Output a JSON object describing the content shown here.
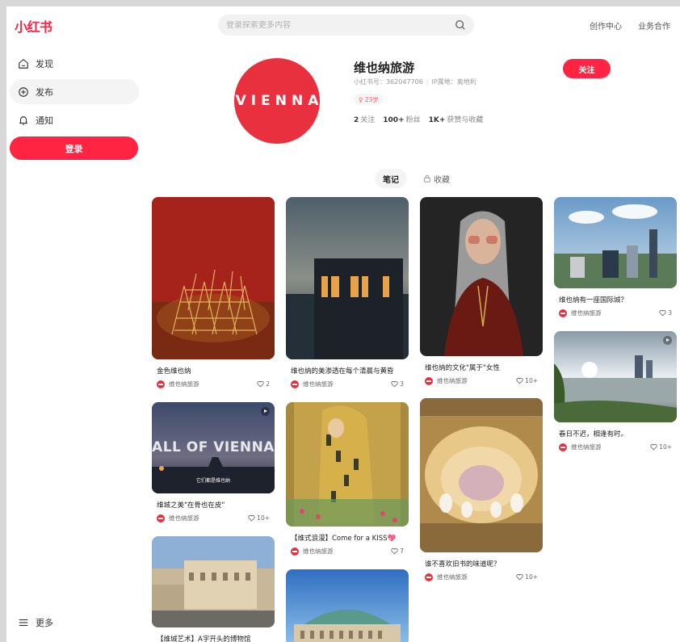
{
  "app": {
    "logo": "小红书"
  },
  "search": {
    "placeholder": "登录探索更多内容"
  },
  "topnav": {
    "creator": "创作中心",
    "business": "业务合作"
  },
  "sidebar": {
    "items": [
      {
        "label": "发现",
        "icon": "home-icon"
      },
      {
        "label": "发布",
        "icon": "plus-icon"
      },
      {
        "label": "通知",
        "icon": "bell-icon"
      }
    ],
    "login": "登录",
    "more": "更多"
  },
  "profile": {
    "avatar_text": "VIENNA",
    "name": "维也纳旅游",
    "id_label": "小红书号：362047706",
    "ip_label": "IP属地：奥地利",
    "tag": "♀ 23岁",
    "following": "2",
    "following_label": "关注",
    "fans": "100+",
    "fans_label": "粉丝",
    "likes": "1K+",
    "likes_label": "获赞与收藏",
    "follow_btn": "关注"
  },
  "tabs": {
    "notes": "笔记",
    "collect": "收藏"
  },
  "cards": [
    {
      "title": "金色维也纳",
      "author": "维也纳旅游",
      "likes": "2"
    },
    {
      "title": "维也纳的美渗透在每个清晨与黄昏",
      "author": "维也纳旅游",
      "likes": "3"
    },
    {
      "title": "维也纳的文化\"属于\"女性",
      "author": "维也纳旅游",
      "likes": "10+"
    },
    {
      "title": "维也纳有一座国际城？",
      "author": "维也纳旅游",
      "likes": "3"
    },
    {
      "title": "春日不迟，相逢有时。",
      "author": "维也纳旅游",
      "likes": "10+"
    },
    {
      "title": "维城之美\"在骨也在皮\"",
      "author": "维也纳旅游",
      "likes": "10+",
      "overlay_big": "ALL OF VIENNA",
      "overlay_small": "它们都是维也纳"
    },
    {
      "title": "【维式浪漫】Come for a KISS💖",
      "author": "维也纳旅游",
      "likes": "7"
    },
    {
      "title": "谁不喜欢旧书的味道呢？",
      "author": "维也纳旅游",
      "likes": "10+"
    },
    {
      "title": "【维城艺术】A字开头的博物馆",
      "author": "",
      "likes": ""
    }
  ],
  "colors": {
    "brand": "#ff2442"
  }
}
